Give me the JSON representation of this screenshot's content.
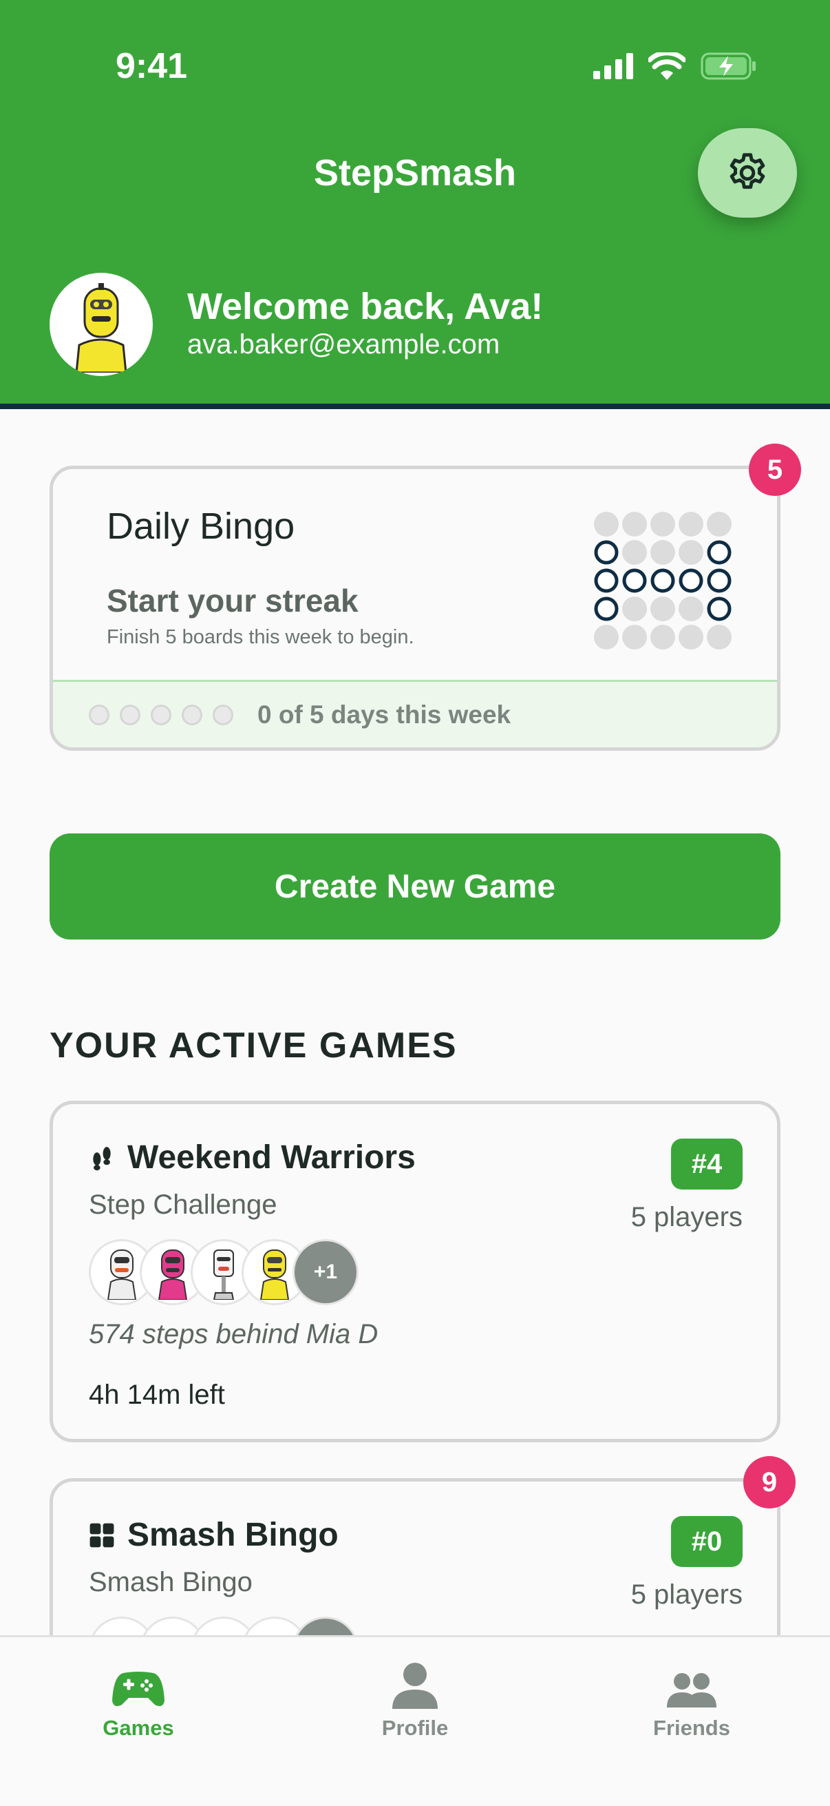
{
  "status_bar": {
    "time": "9:41"
  },
  "header": {
    "app_title": "StepSmash",
    "welcome": "Welcome back, Ava!",
    "email": "ava.baker@example.com",
    "settings_icon": "gear-icon"
  },
  "daily_bingo": {
    "title": "Daily Bingo",
    "subtitle": "Start your streak",
    "hint": "Finish 5 boards this week to begin.",
    "days_text": "0 of 5 days this week",
    "days_completed": 0,
    "days_total": 5,
    "badge": "5"
  },
  "create_button": {
    "label": "Create New Game"
  },
  "active_games": {
    "title": "YOUR ACTIVE GAMES",
    "games": [
      {
        "icon": "footsteps-icon",
        "name": "Weekend Warriors",
        "type": "Step Challenge",
        "rank": "#4",
        "players": "5 players",
        "more": "+1",
        "behind": "574 steps behind Mia D",
        "time_left": "4h 14m left"
      },
      {
        "icon": "grid-icon",
        "name": "Smash Bingo",
        "type": "Smash Bingo",
        "rank": "#0",
        "players": "5 players",
        "badge": "9"
      }
    ]
  },
  "tabbar": {
    "tabs": [
      {
        "label": "Games",
        "icon": "gamepad-icon",
        "active": true
      },
      {
        "label": "Profile",
        "icon": "person-icon",
        "active": false
      },
      {
        "label": "Friends",
        "icon": "people-icon",
        "active": false
      }
    ]
  },
  "colors": {
    "brand_green": "#3aa63a",
    "badge_pink": "#e8336e",
    "navy": "#0f2d44",
    "inactive_gray": "#858d89"
  }
}
